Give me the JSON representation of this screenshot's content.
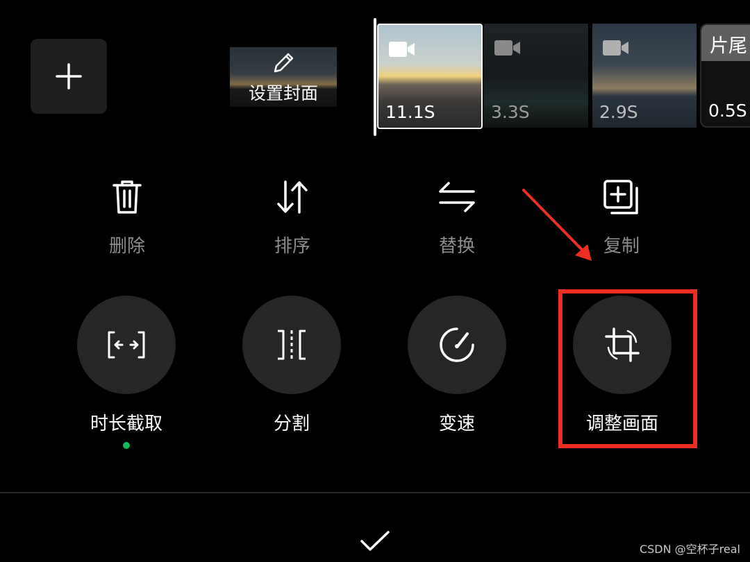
{
  "toolbar_top": {
    "add_label": "+",
    "cover_label": "设置封面"
  },
  "clips": [
    {
      "duration": "11.1S",
      "selected": true
    },
    {
      "duration": "3.3S"
    },
    {
      "duration": "2.9S"
    },
    {
      "duration": "0.5S",
      "tag": "片尾"
    }
  ],
  "actions": [
    {
      "label": "删除",
      "icon": "trash-icon"
    },
    {
      "label": "排序",
      "icon": "sort-arrows-icon"
    },
    {
      "label": "替换",
      "icon": "swap-icon"
    },
    {
      "label": "复制",
      "icon": "copy-icon"
    }
  ],
  "tools": [
    {
      "label": "时长截取",
      "icon": "trim-icon"
    },
    {
      "label": "分割",
      "icon": "split-icon"
    },
    {
      "label": "变速",
      "icon": "speed-icon"
    },
    {
      "label": "调整画面",
      "icon": "crop-icon"
    }
  ],
  "colors": {
    "highlight": "#ef2f24",
    "active_dot": "#16b65a"
  },
  "watermark": "CSDN @空杯子real"
}
